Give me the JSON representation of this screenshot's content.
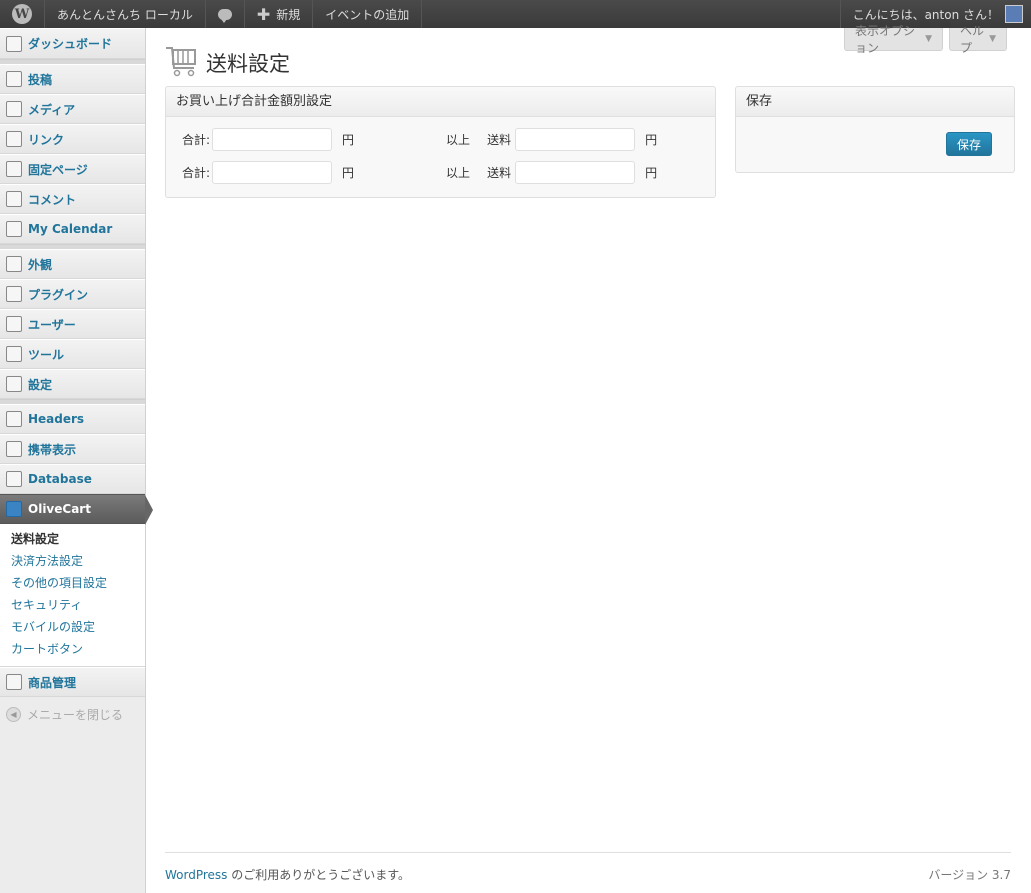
{
  "adminbar": {
    "site_name": "あんとんさんち ローカル",
    "new_label": "新規",
    "add_event": "イベントの追加",
    "greeting": "こんにちは、anton さん！"
  },
  "screen_meta": {
    "options_label": "表示オプション",
    "help_label": "ヘルプ"
  },
  "sidebar": {
    "items": [
      {
        "label": "ダッシュボード",
        "icon": "dashboard-icon"
      },
      {
        "label": "投稿",
        "icon": "pin-icon"
      },
      {
        "label": "メディア",
        "icon": "media-icon"
      },
      {
        "label": "リンク",
        "icon": "link-icon"
      },
      {
        "label": "固定ページ",
        "icon": "pages-icon"
      },
      {
        "label": "コメント",
        "icon": "comment-icon"
      },
      {
        "label": "My Calendar",
        "icon": "calendar-icon"
      },
      {
        "label": "外観",
        "icon": "appearance-icon"
      },
      {
        "label": "プラグイン",
        "icon": "plugin-icon"
      },
      {
        "label": "ユーザー",
        "icon": "users-icon"
      },
      {
        "label": "ツール",
        "icon": "tools-icon"
      },
      {
        "label": "設定",
        "icon": "settings-icon"
      },
      {
        "label": "Headers",
        "icon": "headers-icon"
      },
      {
        "label": "携帯表示",
        "icon": "mobile-icon"
      },
      {
        "label": "Database",
        "icon": "database-icon"
      },
      {
        "label": "OliveCart",
        "icon": "cart-icon"
      },
      {
        "label": "商品管理",
        "icon": "folder-icon"
      }
    ],
    "submenu": [
      "送料設定",
      "決済方法設定",
      "その他の項目設定",
      "セキュリティ",
      "モバイルの設定",
      "カートボタン"
    ],
    "collapse_label": "メニューを閉じる"
  },
  "page": {
    "title": "送料設定"
  },
  "shipping_box": {
    "title": "お買い上げ合計金額別設定",
    "total_label": "合計:",
    "yen": "円",
    "over_label": "以上",
    "shipping_label": "送料",
    "rows": [
      {
        "total": "",
        "shipping": ""
      },
      {
        "total": "",
        "shipping": ""
      }
    ]
  },
  "save_box": {
    "title": "保存",
    "button": "保存"
  },
  "footer": {
    "wp_link": "WordPress",
    "thanks": " のご利用ありがとうございます。",
    "version": "バージョン 3.7"
  }
}
